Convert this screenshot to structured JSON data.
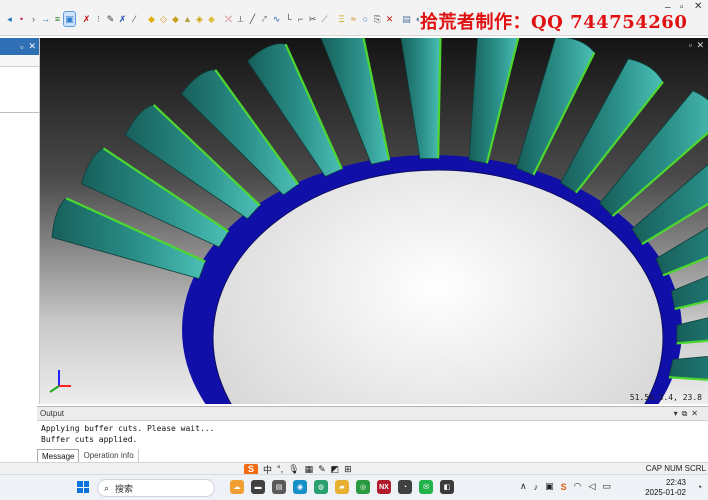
{
  "toolbar": {
    "watermark": "拾荒者制作：QQ 744754260",
    "window_controls": {
      "minimize": "–",
      "maximize": "▫",
      "close": "✕"
    },
    "groups": [
      {
        "icons": [
          {
            "name": "arrow-left-icon",
            "glyph": "◂",
            "color": "#1f6fc0"
          },
          {
            "name": "dot-icon",
            "glyph": "•",
            "color": "#c02060"
          },
          {
            "name": "chevron-right-icon",
            "glyph": "›",
            "color": "#555"
          },
          {
            "name": "arrow-right-icon",
            "glyph": "→",
            "color": "#2060c0"
          },
          {
            "name": "layer-icon",
            "glyph": "≡",
            "color": "#2a7a2a"
          },
          {
            "name": "selected-tool-icon",
            "glyph": "▣",
            "color": "#2a7ad0"
          }
        ]
      },
      {
        "icons": [
          {
            "name": "cross-icon",
            "glyph": "✗",
            "color": "#c01010"
          },
          {
            "name": "pin-icon",
            "glyph": "⁝",
            "color": "#666"
          },
          {
            "name": "pen-icon",
            "glyph": "✎",
            "color": "#333"
          },
          {
            "name": "edit-x-icon",
            "glyph": "✗",
            "color": "#2050b0"
          },
          {
            "name": "knife-icon",
            "glyph": "⁄",
            "color": "#444"
          }
        ]
      },
      {
        "icons": [
          {
            "name": "surface-icon",
            "glyph": "◆",
            "color": "#e0b000"
          },
          {
            "name": "surface-2-icon",
            "glyph": "◇",
            "color": "#d09000"
          },
          {
            "name": "surface-3-icon",
            "glyph": "◆",
            "color": "#c8a020"
          },
          {
            "name": "surface-4-icon",
            "glyph": "▲",
            "color": "#b8a040"
          },
          {
            "name": "surface-5-icon",
            "glyph": "◈",
            "color": "#d0a000"
          },
          {
            "name": "surface-6-icon",
            "glyph": "◆",
            "color": "#e0c040"
          }
        ]
      },
      {
        "icons": [
          {
            "name": "trim-icon",
            "glyph": "⤫",
            "color": "#c02020"
          },
          {
            "name": "mirror-icon",
            "glyph": "⟂",
            "color": "#555"
          },
          {
            "name": "line-icon",
            "glyph": "╱",
            "color": "#444"
          },
          {
            "name": "offset-icon",
            "glyph": "⤤",
            "color": "#666"
          },
          {
            "name": "curve-icon",
            "glyph": "∿",
            "color": "#3060c0"
          },
          {
            "name": "corner-icon",
            "glyph": "└",
            "color": "#444"
          },
          {
            "name": "chamfer-icon",
            "glyph": "⌐",
            "color": "#555"
          },
          {
            "name": "cut-icon",
            "glyph": "✂",
            "color": "#444"
          },
          {
            "name": "join-icon",
            "glyph": "⟋",
            "color": "#777"
          }
        ]
      },
      {
        "icons": [
          {
            "name": "text-icon",
            "glyph": "Ξ",
            "color": "#c0a000"
          },
          {
            "name": "wave-icon",
            "glyph": "≈",
            "color": "#d08000"
          },
          {
            "name": "ring-icon",
            "glyph": "○",
            "color": "#3a6fc0"
          },
          {
            "name": "copy-icon",
            "glyph": "⎘",
            "color": "#555"
          },
          {
            "name": "delete-icon",
            "glyph": "✕",
            "color": "#c01010"
          }
        ]
      },
      {
        "icons": [
          {
            "name": "shade-icon",
            "glyph": "▤",
            "color": "#5070a0"
          },
          {
            "name": "view-icon",
            "glyph": "◐",
            "color": "#5070a0"
          }
        ]
      }
    ]
  },
  "left_panel": {
    "controls": {
      "pin": "▫",
      "close": "✕"
    }
  },
  "viewport": {
    "controls": {
      "pin": "▫",
      "close": "✕"
    },
    "readout": "51.5%  3.4, 23.8",
    "colors": {
      "hub": "#1010a8",
      "blade": "#1e7a74",
      "blade_light": "#37a9a0",
      "edge": "#4cd830",
      "bore": "#f2f2f2"
    }
  },
  "output": {
    "title": "Output",
    "controls": [
      "▾",
      "⧉",
      "✕"
    ],
    "lines": [
      "Applying buffer cuts. Please wait...",
      "Buffer cuts applied."
    ],
    "tabs": [
      {
        "label": "Message",
        "active": true
      },
      {
        "label": "Operation info",
        "active": false
      }
    ]
  },
  "statusbar": {
    "ime": {
      "logo": "S",
      "mode": "中",
      "items": [
        "°,",
        "🎙",
        "▦",
        "✎",
        "◩",
        "⊞"
      ]
    },
    "capnum": "CAP NUM SCRL"
  },
  "taskbar": {
    "search_placeholder": "搜索",
    "apps": [
      {
        "name": "sky-app-icon",
        "glyph": "☁",
        "bg": "#f0a030"
      },
      {
        "name": "window-app-icon",
        "glyph": "▬",
        "bg": "#404040"
      },
      {
        "name": "files-app-icon",
        "glyph": "▤",
        "bg": "#5a5a5a"
      },
      {
        "name": "edge-app-icon",
        "glyph": "◉",
        "bg": "#1790c8"
      },
      {
        "name": "msedge-app-icon",
        "glyph": "◍",
        "bg": "#2aa070"
      },
      {
        "name": "folder-app-icon",
        "glyph": "▰",
        "bg": "#e8b030"
      },
      {
        "name": "chrome-app-icon",
        "glyph": "◎",
        "bg": "#2a9a40"
      },
      {
        "name": "nx-app-icon",
        "glyph": "NX",
        "bg": "#b01a2a"
      },
      {
        "name": "qq-app-icon",
        "glyph": "◔",
        "bg": "#404040"
      },
      {
        "name": "wechat-app-icon",
        "glyph": "✉",
        "bg": "#22b24a"
      },
      {
        "name": "camera-app-icon",
        "glyph": "◧",
        "bg": "#3a3a3a"
      }
    ],
    "tray": [
      {
        "name": "chevron-up-icon",
        "glyph": "∧"
      },
      {
        "name": "mic-tray-icon",
        "glyph": "♪"
      },
      {
        "name": "tray-app-icon",
        "glyph": "▣"
      },
      {
        "name": "sogou-tray-icon",
        "glyph": "S"
      },
      {
        "name": "wifi-icon",
        "glyph": "◠"
      },
      {
        "name": "volume-icon",
        "glyph": "◁"
      },
      {
        "name": "battery-icon",
        "glyph": "▭"
      }
    ],
    "time": "22:43",
    "date": "2025-01-02",
    "bell": "◔"
  }
}
